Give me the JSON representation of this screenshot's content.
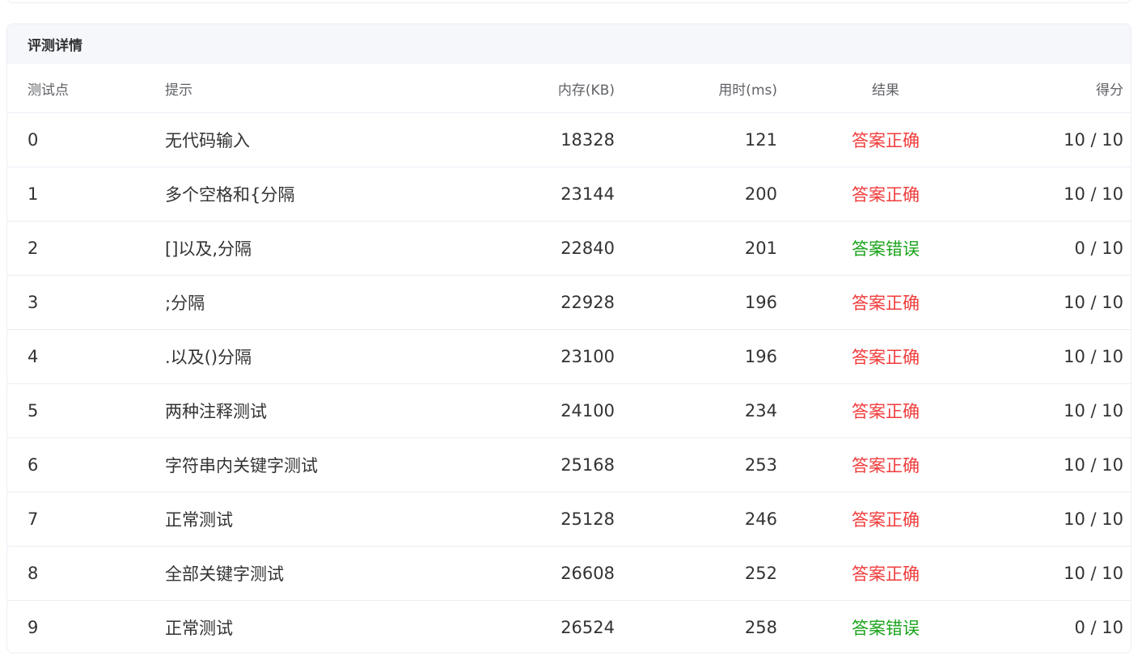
{
  "panel": {
    "title": "评测详情"
  },
  "table": {
    "headers": {
      "id": "测试点",
      "hint": "提示",
      "memory": "内存(KB)",
      "time": "用时(ms)",
      "result": "结果",
      "score": "得分"
    },
    "rows": [
      {
        "id": "0",
        "hint": "无代码输入",
        "memory": "18328",
        "time": "121",
        "result": "答案正确",
        "status": "ok",
        "score": "10 / 10"
      },
      {
        "id": "1",
        "hint": "多个空格和{分隔",
        "memory": "23144",
        "time": "200",
        "result": "答案正确",
        "status": "ok",
        "score": "10 / 10"
      },
      {
        "id": "2",
        "hint": "[]以及,分隔",
        "memory": "22840",
        "time": "201",
        "result": "答案错误",
        "status": "wrong",
        "score": "0 / 10"
      },
      {
        "id": "3",
        "hint": ";分隔",
        "memory": "22928",
        "time": "196",
        "result": "答案正确",
        "status": "ok",
        "score": "10 / 10"
      },
      {
        "id": "4",
        "hint": ".以及()分隔",
        "memory": "23100",
        "time": "196",
        "result": "答案正确",
        "status": "ok",
        "score": "10 / 10"
      },
      {
        "id": "5",
        "hint": "两种注释测试",
        "memory": "24100",
        "time": "234",
        "result": "答案正确",
        "status": "ok",
        "score": "10 / 10"
      },
      {
        "id": "6",
        "hint": "字符串内关键字测试",
        "memory": "25168",
        "time": "253",
        "result": "答案正确",
        "status": "ok",
        "score": "10 / 10"
      },
      {
        "id": "7",
        "hint": "正常测试",
        "memory": "25128",
        "time": "246",
        "result": "答案正确",
        "status": "ok",
        "score": "10 / 10"
      },
      {
        "id": "8",
        "hint": "全部关键字测试",
        "memory": "26608",
        "time": "252",
        "result": "答案正确",
        "status": "ok",
        "score": "10 / 10"
      },
      {
        "id": "9",
        "hint": "正常测试",
        "memory": "26524",
        "time": "258",
        "result": "答案错误",
        "status": "wrong",
        "score": "0 / 10"
      }
    ]
  },
  "colors": {
    "correct": "#f03c3c",
    "wrong": "#1ba31b",
    "header_bg": "#f5f7fa",
    "border": "#ebeef5"
  }
}
